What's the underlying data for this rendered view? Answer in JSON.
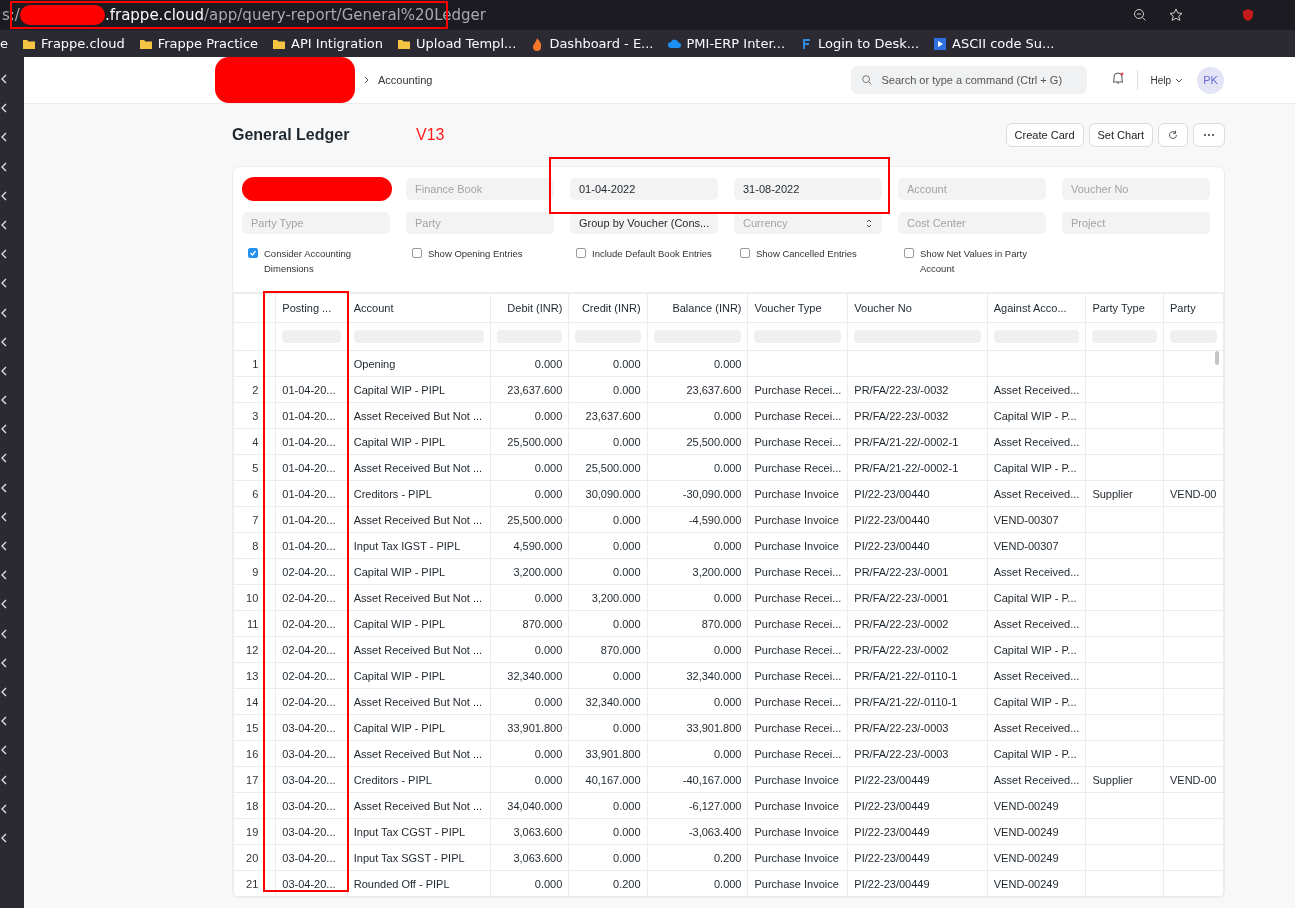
{
  "browser": {
    "url_prefix": "s:/",
    "url_host": ".frappe.cloud",
    "url_path": "/app/query-report/General%20Ledger",
    "bookmarks": [
      {
        "label": "e",
        "kind": "plain"
      },
      {
        "label": "Frappe.cloud",
        "kind": "folder"
      },
      {
        "label": "Frappe Practice",
        "kind": "folder"
      },
      {
        "label": "API Intigration",
        "kind": "folder"
      },
      {
        "label": "Upload Templ...",
        "kind": "folder"
      },
      {
        "label": "Dashboard - E...",
        "kind": "flame"
      },
      {
        "label": "PMI-ERP Inter...",
        "kind": "cloud"
      },
      {
        "label": "Login to Desk...",
        "kind": "letter"
      },
      {
        "label": "ASCII code Su...",
        "kind": "play"
      }
    ]
  },
  "navbar": {
    "breadcrumb": "Accounting",
    "search": {
      "placeholder": "Search or type a command (Ctrl + G)"
    },
    "help": "Help",
    "avatar": "PK"
  },
  "page": {
    "title": "General Ledger",
    "annotation": "V13",
    "actions": [
      "Create Card",
      "Set Chart"
    ]
  },
  "filters": [
    {
      "kind": "redacted"
    },
    {
      "kind": "input",
      "placeholder": "Finance Book"
    },
    {
      "kind": "input",
      "value": "01-04-2022"
    },
    {
      "kind": "input",
      "value": "31-08-2022"
    },
    {
      "kind": "input",
      "placeholder": "Account"
    },
    {
      "kind": "input",
      "placeholder": "Voucher No"
    },
    {
      "kind": "input",
      "placeholder": "Party Type"
    },
    {
      "kind": "input",
      "placeholder": "Party"
    },
    {
      "kind": "select",
      "value": "Group by Voucher (Cons..."
    },
    {
      "kind": "select",
      "placeholder": "Currency"
    },
    {
      "kind": "input",
      "placeholder": "Cost Center"
    },
    {
      "kind": "input",
      "placeholder": "Project"
    }
  ],
  "checkboxes": [
    {
      "label": "Consider Accounting Dimensions",
      "checked": true
    },
    {
      "label": "Show Opening Entries",
      "checked": false
    },
    {
      "label": "Include Default Book Entries",
      "checked": false
    },
    {
      "label": "Show Cancelled Entries",
      "checked": false
    },
    {
      "label": "Show Net Values in Party Account",
      "checked": false
    }
  ],
  "table": {
    "columns": [
      "",
      "Posting ...",
      "Account",
      "Debit (INR)",
      "Credit (INR)",
      "Balance (INR)",
      "Voucher Type",
      "Voucher No",
      "Against Acco...",
      "Party Type",
      "Party"
    ],
    "rows": [
      [
        "1",
        "",
        "Opening",
        "0.000",
        "0.000",
        "0.000",
        "",
        "",
        "",
        "",
        ""
      ],
      [
        "2",
        "01-04-20...",
        "Capital WIP - PIPL",
        "23,637.600",
        "0.000",
        "23,637.600",
        "Purchase Recei...",
        "PR/FA/22-23/-0032",
        "Asset Received...",
        "",
        ""
      ],
      [
        "3",
        "01-04-20...",
        "Asset Received But Not ...",
        "0.000",
        "23,637.600",
        "0.000",
        "Purchase Recei...",
        "PR/FA/22-23/-0032",
        "Capital WIP - P...",
        "",
        ""
      ],
      [
        "4",
        "01-04-20...",
        "Capital WIP - PIPL",
        "25,500.000",
        "0.000",
        "25,500.000",
        "Purchase Recei...",
        "PR/FA/21-22/-0002-1",
        "Asset Received...",
        "",
        ""
      ],
      [
        "5",
        "01-04-20...",
        "Asset Received But Not ...",
        "0.000",
        "25,500.000",
        "0.000",
        "Purchase Recei...",
        "PR/FA/21-22/-0002-1",
        "Capital WIP - P...",
        "",
        ""
      ],
      [
        "6",
        "01-04-20...",
        "Creditors - PIPL",
        "0.000",
        "30,090.000",
        "-30,090.000",
        "Purchase Invoice",
        "PI/22-23/00440",
        "Asset Received...",
        "Supplier",
        "VEND-00"
      ],
      [
        "7",
        "01-04-20...",
        "Asset Received But Not ...",
        "25,500.000",
        "0.000",
        "-4,590.000",
        "Purchase Invoice",
        "PI/22-23/00440",
        "VEND-00307",
        "",
        ""
      ],
      [
        "8",
        "01-04-20...",
        "Input Tax IGST - PIPL",
        "4,590.000",
        "0.000",
        "0.000",
        "Purchase Invoice",
        "PI/22-23/00440",
        "VEND-00307",
        "",
        ""
      ],
      [
        "9",
        "02-04-20...",
        "Capital WIP - PIPL",
        "3,200.000",
        "0.000",
        "3,200.000",
        "Purchase Recei...",
        "PR/FA/22-23/-0001",
        "Asset Received...",
        "",
        ""
      ],
      [
        "10",
        "02-04-20...",
        "Asset Received But Not ...",
        "0.000",
        "3,200.000",
        "0.000",
        "Purchase Recei...",
        "PR/FA/22-23/-0001",
        "Capital WIP - P...",
        "",
        ""
      ],
      [
        "11",
        "02-04-20...",
        "Capital WIP - PIPL",
        "870.000",
        "0.000",
        "870.000",
        "Purchase Recei...",
        "PR/FA/22-23/-0002",
        "Asset Received...",
        "",
        ""
      ],
      [
        "12",
        "02-04-20...",
        "Asset Received But Not ...",
        "0.000",
        "870.000",
        "0.000",
        "Purchase Recei...",
        "PR/FA/22-23/-0002",
        "Capital WIP - P...",
        "",
        ""
      ],
      [
        "13",
        "02-04-20...",
        "Capital WIP - PIPL",
        "32,340.000",
        "0.000",
        "32,340.000",
        "Purchase Recei...",
        "PR/FA/21-22/-0110-1",
        "Asset Received...",
        "",
        ""
      ],
      [
        "14",
        "02-04-20...",
        "Asset Received But Not ...",
        "0.000",
        "32,340.000",
        "0.000",
        "Purchase Recei...",
        "PR/FA/21-22/-0110-1",
        "Capital WIP - P...",
        "",
        ""
      ],
      [
        "15",
        "03-04-20...",
        "Capital WIP - PIPL",
        "33,901.800",
        "0.000",
        "33,901.800",
        "Purchase Recei...",
        "PR/FA/22-23/-0003",
        "Asset Received...",
        "",
        ""
      ],
      [
        "16",
        "03-04-20...",
        "Asset Received But Not ...",
        "0.000",
        "33,901.800",
        "0.000",
        "Purchase Recei...",
        "PR/FA/22-23/-0003",
        "Capital WIP - P...",
        "",
        ""
      ],
      [
        "17",
        "03-04-20...",
        "Creditors - PIPL",
        "0.000",
        "40,167.000",
        "-40,167.000",
        "Purchase Invoice",
        "PI/22-23/00449",
        "Asset Received...",
        "Supplier",
        "VEND-00"
      ],
      [
        "18",
        "03-04-20...",
        "Asset Received But Not ...",
        "34,040.000",
        "0.000",
        "-6,127.000",
        "Purchase Invoice",
        "PI/22-23/00449",
        "VEND-00249",
        "",
        ""
      ],
      [
        "19",
        "03-04-20...",
        "Input Tax CGST - PIPL",
        "3,063.600",
        "0.000",
        "-3,063.400",
        "Purchase Invoice",
        "PI/22-23/00449",
        "VEND-00249",
        "",
        ""
      ],
      [
        "20",
        "03-04-20...",
        "Input Tax SGST - PIPL",
        "3,063.600",
        "0.000",
        "0.200",
        "Purchase Invoice",
        "PI/22-23/00449",
        "VEND-00249",
        "",
        ""
      ],
      [
        "21",
        "03-04-20...",
        "Rounded Off - PIPL",
        "0.000",
        "0.200",
        "0.000",
        "Purchase Invoice",
        "PI/22-23/00449",
        "VEND-00249",
        "",
        ""
      ]
    ]
  }
}
